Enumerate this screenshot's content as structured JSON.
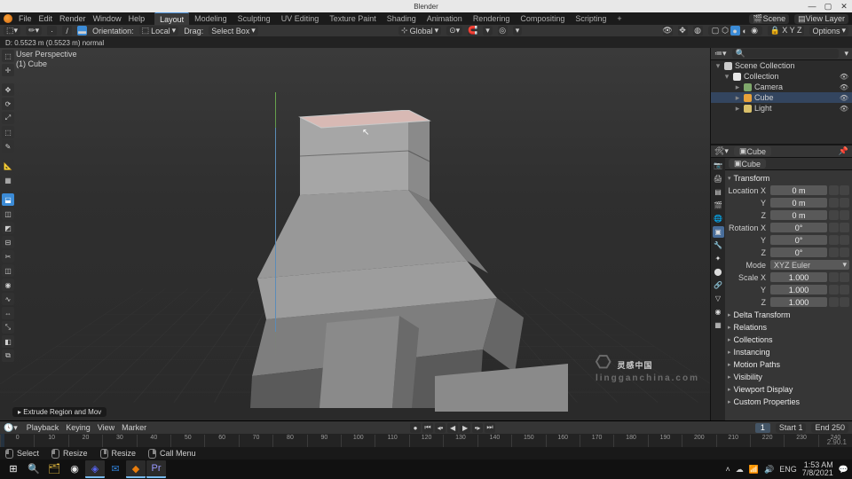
{
  "window": {
    "title": "Blender"
  },
  "winbtns": {
    "min": "—",
    "max": "▢",
    "close": "✕"
  },
  "menu": [
    "File",
    "Edit",
    "Render",
    "Window",
    "Help"
  ],
  "workspaces": [
    "Layout",
    "Modeling",
    "Sculpting",
    "UV Editing",
    "Texture Paint",
    "Shading",
    "Animation",
    "Rendering",
    "Compositing",
    "Scripting",
    "+"
  ],
  "topright": {
    "scene_label": "Scene",
    "viewlayer_label": "View Layer"
  },
  "hdr": {
    "mode": "",
    "mode_icon": "edit-mode-icon",
    "orient_label": "Orientation:",
    "orient_val": "Local",
    "drag_label": "Drag:",
    "drag_val": "Select Box",
    "transform_space": "Global",
    "xyz": "X Y Z",
    "options": "Options"
  },
  "info_line": "D: 0.5523 m (0.5523 m) normal",
  "hud": {
    "persp": "User Perspective",
    "obj": "(1) Cube"
  },
  "left_tools": [
    {
      "n": "tweak-tool",
      "g": "⬚"
    },
    {
      "n": "cursor-tool",
      "g": "✛"
    },
    {
      "n": "move-tool",
      "g": "✥"
    },
    {
      "n": "rotate-tool",
      "g": "⟳"
    },
    {
      "n": "scale-tool",
      "g": "⤢"
    },
    {
      "n": "transform-tool",
      "g": "⬚"
    },
    {
      "n": "annotate-tool",
      "g": "✎"
    },
    {
      "n": "measure-tool",
      "g": "📐"
    },
    {
      "n": "add-cube-tool",
      "g": "▦"
    },
    {
      "n": "extrude-tool",
      "g": "⬓",
      "act": true
    },
    {
      "n": "inset-tool",
      "g": "◫"
    },
    {
      "n": "bevel-tool",
      "g": "◩"
    },
    {
      "n": "loopcut-tool",
      "g": "⊟"
    },
    {
      "n": "knife-tool",
      "g": "✂"
    },
    {
      "n": "polybuild-tool",
      "g": "◫"
    },
    {
      "n": "spin-tool",
      "g": "◉"
    },
    {
      "n": "smooth-tool",
      "g": "∿"
    },
    {
      "n": "slide-tool",
      "g": "⇔"
    },
    {
      "n": "shrink-tool",
      "g": "⤡"
    },
    {
      "n": "shear-tool",
      "g": "◧"
    },
    {
      "n": "rip-tool",
      "g": "⧉"
    }
  ],
  "status_pill": "▸ Extrude Region and Mov",
  "outliner": {
    "root": "Scene Collection",
    "items": [
      {
        "n": "Collection",
        "ic": "#e8e8e8",
        "d": 1,
        "tw": "▾"
      },
      {
        "n": "Camera",
        "ic": "#7fa86b",
        "d": 2,
        "tw": "▸"
      },
      {
        "n": "Cube",
        "ic": "#e8a23a",
        "d": 2,
        "sel": true,
        "tw": "▸"
      },
      {
        "n": "Light",
        "ic": "#d9c06a",
        "d": 2,
        "tw": "▸"
      }
    ]
  },
  "props": {
    "crumb1": "Cube",
    "crumb2": "Cube",
    "sections": {
      "transform": "Transform",
      "loc": "Location X",
      "y": "Y",
      "z": "Z",
      "rot": "Rotation X",
      "mode": "Mode",
      "scl": "Scale X",
      "loc_vals": [
        "0 m",
        "0 m",
        "0 m"
      ],
      "rot_vals": [
        "0°",
        "0°",
        "0°"
      ],
      "mode_val": "XYZ Euler",
      "scl_vals": [
        "1.000",
        "1.000",
        "1.000"
      ],
      "delta": "Delta Transform",
      "rel": "Relations",
      "col": "Collections",
      "inst": "Instancing",
      "mp": "Motion Paths",
      "vis": "Visibility",
      "vd": "Viewport Display",
      "cp": "Custom Properties"
    },
    "vtabs": [
      {
        "n": "render-tab",
        "g": "📷"
      },
      {
        "n": "output-tab",
        "g": "🖨"
      },
      {
        "n": "viewlayer-tab",
        "g": "▤"
      },
      {
        "n": "scene-tab",
        "g": "🎬"
      },
      {
        "n": "world-tab",
        "g": "🌐"
      },
      {
        "n": "object-tab",
        "g": "▣",
        "act": true
      },
      {
        "n": "modifier-tab",
        "g": "🔧"
      },
      {
        "n": "particle-tab",
        "g": "✦"
      },
      {
        "n": "physics-tab",
        "g": "⬤"
      },
      {
        "n": "constraint-tab",
        "g": "🔗"
      },
      {
        "n": "mesh-tab",
        "g": "▽"
      },
      {
        "n": "material-tab",
        "g": "◉"
      },
      {
        "n": "texture-tab",
        "g": "▦"
      }
    ]
  },
  "timeline": {
    "menus": [
      "Playback",
      "Keying",
      "View",
      "Marker"
    ],
    "current": 1,
    "start_lbl": "Start",
    "start": 1,
    "end_lbl": "End",
    "end": 250,
    "ticks": [
      0,
      10,
      20,
      30,
      40,
      50,
      60,
      70,
      80,
      90,
      100,
      110,
      120,
      130,
      140,
      150,
      160,
      170,
      180,
      190,
      200,
      210,
      220,
      230,
      240
    ],
    "version": "2.90.1"
  },
  "hints": [
    {
      "btn": "l",
      "t": "Select"
    },
    {
      "btn": "l",
      "t": "Resize"
    },
    {
      "btn": "m",
      "t": "Resize"
    },
    {
      "btn": "r",
      "t": "Call Menu"
    }
  ],
  "watermark": {
    "cn": "灵感中国",
    "en": "lingganchina.com"
  },
  "taskbar": {
    "apps": [
      {
        "n": "start-button",
        "c": "#fff",
        "g": "⊞"
      },
      {
        "n": "search-button",
        "c": "#fff",
        "g": "🔍"
      },
      {
        "n": "explorer",
        "c": "#f5c842",
        "g": "🗂"
      },
      {
        "n": "chrome",
        "c": "#e8e8e8",
        "g": "◉"
      },
      {
        "n": "discord",
        "c": "#5865f2",
        "g": "◈",
        "act": true
      },
      {
        "n": "mail",
        "c": "#2f7dd1",
        "g": "✉"
      },
      {
        "n": "blender",
        "c": "#e87d0d",
        "g": "◆",
        "act": true
      },
      {
        "n": "premiere",
        "c": "#9999ff",
        "g": "Pr",
        "act": true
      }
    ],
    "tray": {
      "time": "1:53 AM",
      "date": "7/8/2021",
      "lang": "ENG"
    }
  }
}
